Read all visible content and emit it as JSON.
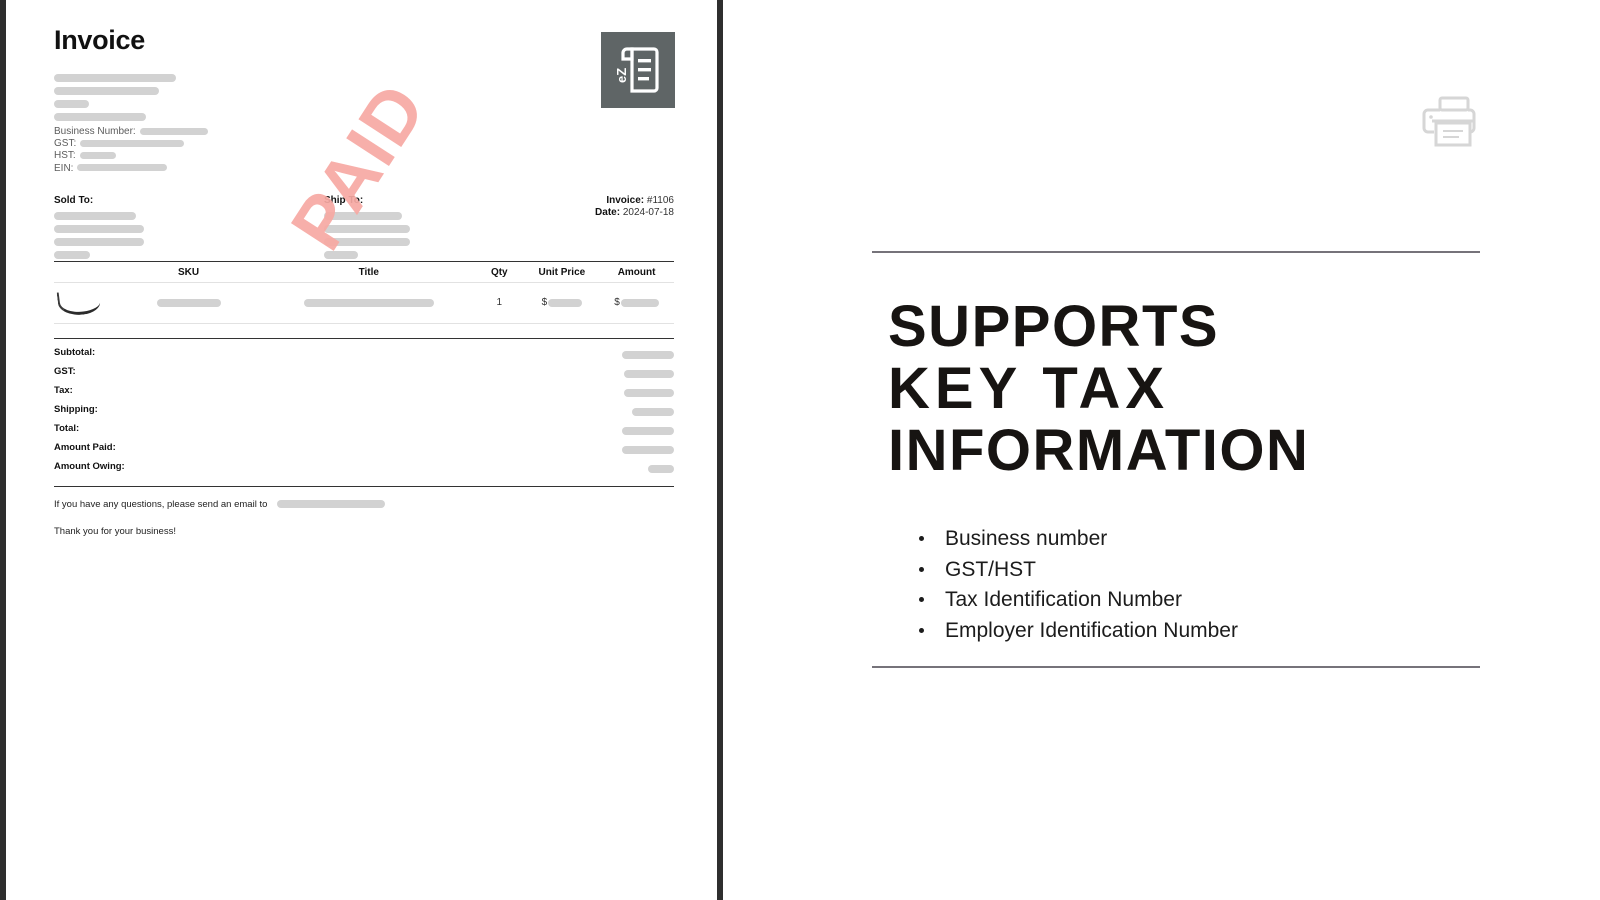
{
  "layout": {
    "divider_color": "#2e2e2e",
    "redaction_color": "#d2d2d2"
  },
  "invoice": {
    "title": "Invoice",
    "logo": {
      "name": "ezinvoice-logo",
      "mark_text": "eZ",
      "background": "#5f6566"
    },
    "tax_labels": {
      "business_number": "Business Number:",
      "gst": "GST:",
      "hst": "HST:",
      "ein": "EIN:"
    },
    "sold_to_label": "Sold To:",
    "ship_to_label": "Ship To:",
    "meta": {
      "invoice_label": "Invoice:",
      "invoice_number": "#1106",
      "date_label": "Date:",
      "date_value": "2024-07-18"
    },
    "table": {
      "columns": [
        "",
        "SKU",
        "Title",
        "Qty",
        "Unit Price",
        "Amount"
      ],
      "rows": [
        {
          "image": "product-thumbnail",
          "sku": "",
          "title": "",
          "qty": "1",
          "unit_price_currency": "$",
          "unit_price": "",
          "amount_currency": "$",
          "amount": ""
        }
      ]
    },
    "totals": [
      {
        "label": "Subtotal:",
        "value": ""
      },
      {
        "label": "GST:",
        "value": ""
      },
      {
        "label": "Tax:",
        "value": ""
      },
      {
        "label": "Shipping:",
        "value": ""
      },
      {
        "label": "Total:",
        "value": ""
      },
      {
        "label": "Amount Paid:",
        "value": ""
      },
      {
        "label": "Amount Owing:",
        "value": ""
      }
    ],
    "footer": {
      "question_line": "If you have any questions, please send an email to",
      "thanks_line": "Thank you for your business!"
    },
    "watermark": {
      "text": "PAID",
      "color": "#f7a9a3"
    }
  },
  "slide": {
    "printer_icon": "printer-icon",
    "heading_lines": [
      "SUPPORTS",
      "KEY TAX",
      "INFORMATION"
    ],
    "bullets": [
      "Business number",
      "GST/HST",
      "Tax Identification Number",
      "Employer Identification Number"
    ]
  }
}
